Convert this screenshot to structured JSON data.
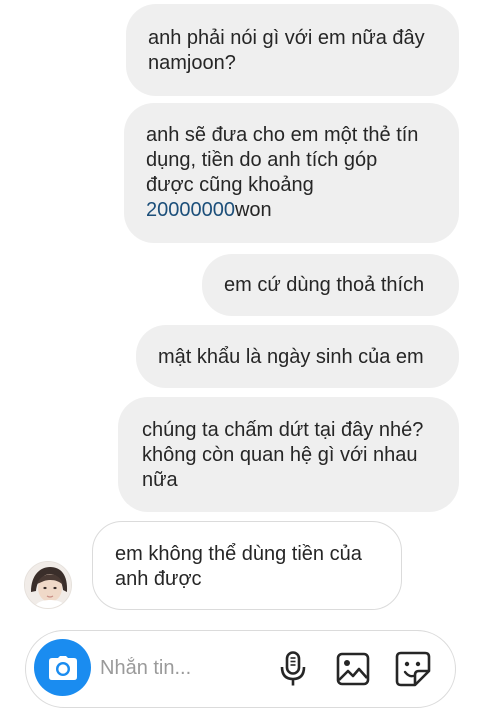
{
  "messages": [
    {
      "lines": [
        "anh phải nói gì với em nữa đây",
        "namjoon?"
      ]
    },
    {
      "lines": [
        "anh sẽ đưa cho em một thẻ tín",
        "dụng, tiền do anh tích góp",
        "được cũng khoảng"
      ],
      "amount": "20000000",
      "amount_suffix": "won"
    },
    {
      "lines": [
        "em cứ dùng thoả thích"
      ]
    },
    {
      "lines": [
        "mật khẩu là ngày sinh của em"
      ]
    },
    {
      "lines": [
        "chúng ta chấm dứt tại đây nhé?",
        "không còn quan hệ gì với nhau",
        "nữa"
      ]
    }
  ],
  "incoming": {
    "lines": [
      "em không thể dùng tiền của",
      "anh được"
    ]
  },
  "composer": {
    "placeholder": "Nhắn tin..."
  },
  "colors": {
    "outgoing_bubble": "#efefef",
    "incoming_border": "#dbdbdb",
    "camera_button": "#1a8cf0",
    "amount_text": "#1c4f7a"
  },
  "icons": {
    "camera": "camera-icon",
    "mic": "microphone-icon",
    "gallery": "image-icon",
    "sticker": "sticker-icon"
  }
}
